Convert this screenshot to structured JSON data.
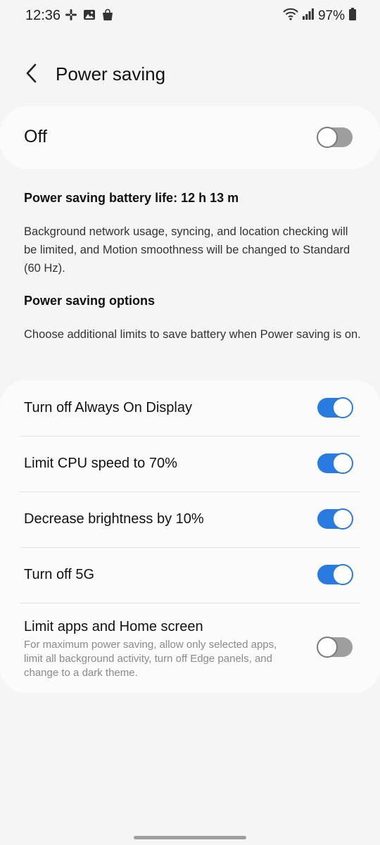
{
  "status_bar": {
    "time": "12:36",
    "battery": "97%",
    "left_icons": [
      "slack-icon",
      "gallery-icon",
      "shopping-bag-icon"
    ],
    "right_icons": [
      "wifi-icon",
      "signal-icon",
      "battery-icon"
    ]
  },
  "header": {
    "title": "Power saving",
    "back_icon": "chevron-left-icon"
  },
  "master": {
    "label": "Off",
    "enabled": false
  },
  "info": {
    "battery_life": "Power saving battery life: 12 h 13 m",
    "description": "Background network usage, syncing, and location checking will be limited, and Motion smoothness will be changed to Standard (60 Hz).",
    "options_heading": "Power saving options",
    "options_description": "Choose additional limits to save battery when Power saving is on."
  },
  "options": [
    {
      "label": "Turn off Always On Display",
      "enabled": true
    },
    {
      "label": "Limit CPU speed to 70%",
      "enabled": true
    },
    {
      "label": "Decrease brightness by 10%",
      "enabled": true
    },
    {
      "label": "Turn off 5G",
      "enabled": true
    },
    {
      "label": "Limit apps and Home screen",
      "sublabel": "For maximum power saving, allow only selected apps, limit all background activity, turn off Edge panels, and change to a dark theme.",
      "enabled": false
    }
  ],
  "colors": {
    "toggle_on": "#2a7be0",
    "toggle_off": "#9e9e9e",
    "background": "#f5f5f5",
    "card": "#fbfbfb"
  }
}
